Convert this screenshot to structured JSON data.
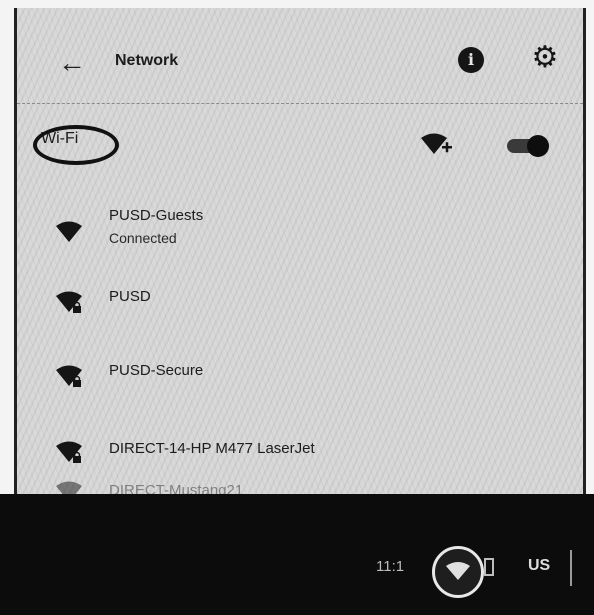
{
  "header": {
    "back_icon": "arrow-left-icon",
    "title": "Network",
    "info_icon": "info-icon",
    "settings_icon": "gear-icon",
    "info_glyph": "i"
  },
  "wifi": {
    "label": "Wi-Fi",
    "add_network_icon": "wifi-add-icon",
    "enabled": true
  },
  "networks": [
    {
      "name": "PUSD-Guests",
      "status": "Connected",
      "locked": false
    },
    {
      "name": "PUSD",
      "status": "",
      "locked": true
    },
    {
      "name": "PUSD-Secure",
      "status": "",
      "locked": true
    },
    {
      "name": "DIRECT-14-HP M477 LaserJet",
      "status": "",
      "locked": true
    },
    {
      "name": "DIRECT-Mustang21",
      "status": "",
      "locked": false
    }
  ],
  "taskbar": {
    "time": "11:1",
    "wifi_icon": "wifi-icon",
    "language": "US"
  },
  "colors": {
    "panel_bg": "#d9d9d9",
    "taskbar_bg": "#0c0c0c",
    "annotation": "#111111"
  }
}
